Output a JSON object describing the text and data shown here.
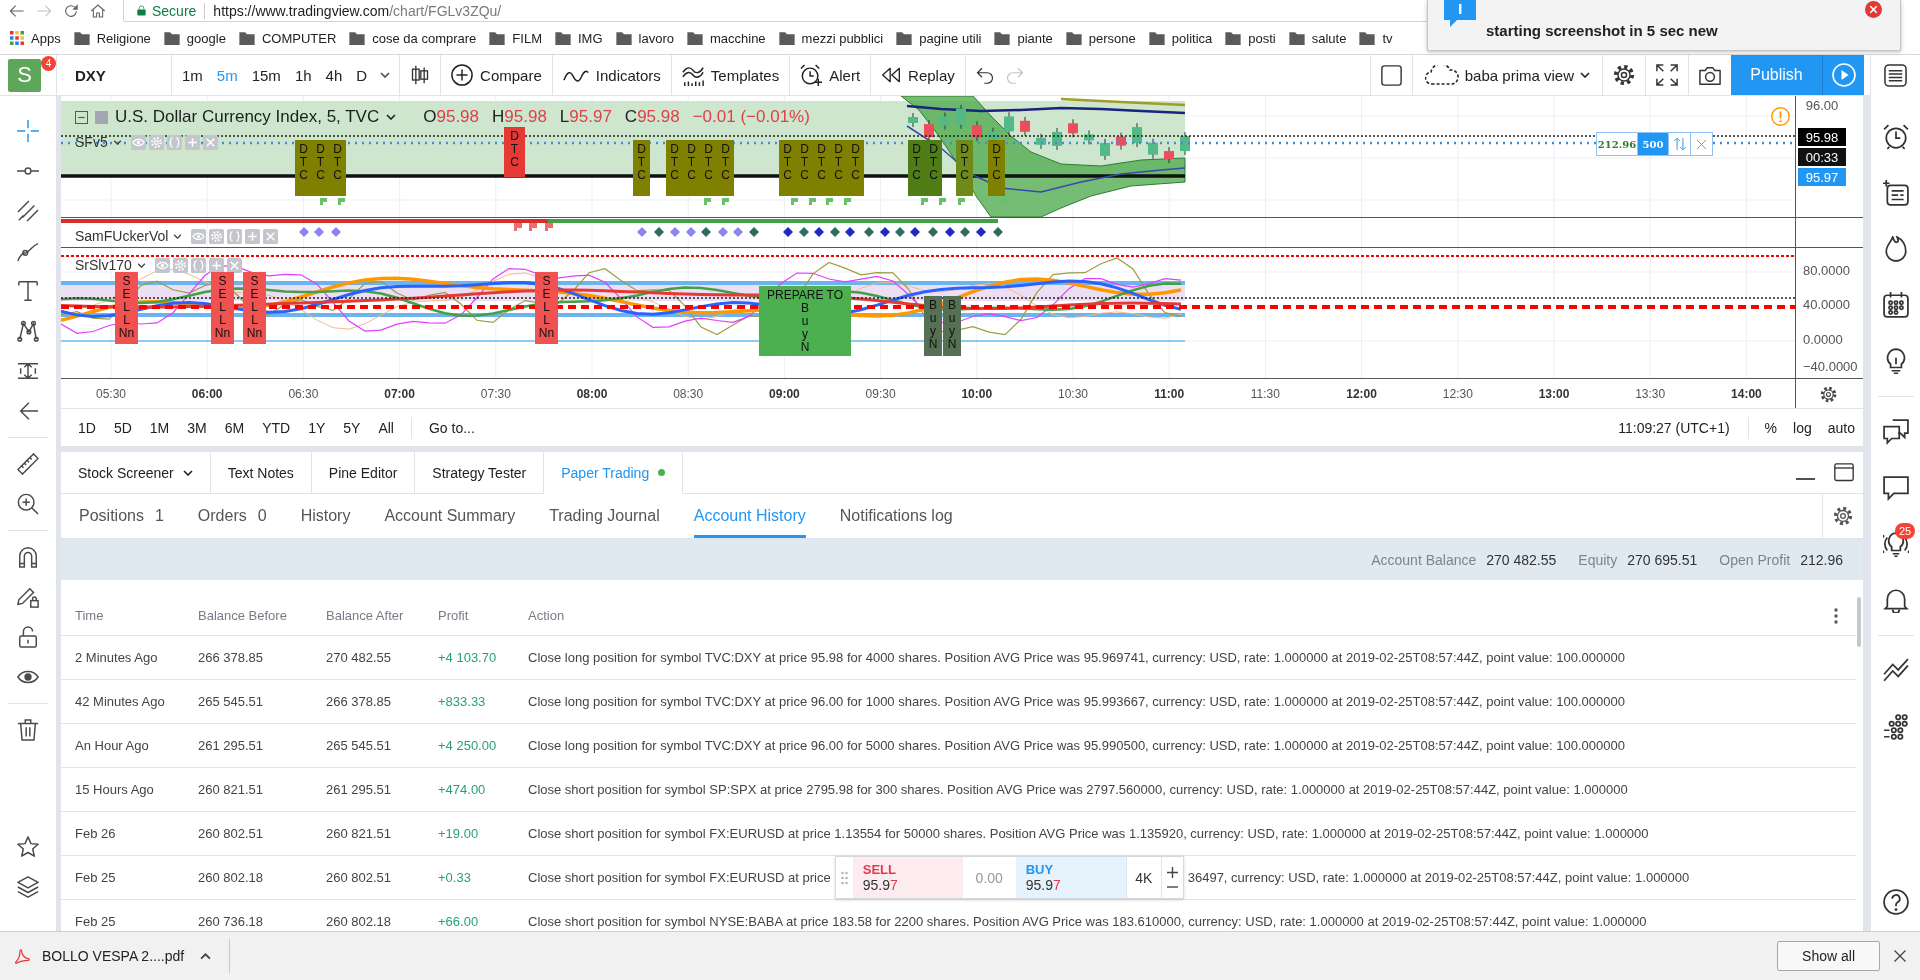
{
  "browser": {
    "secure_label": "Secure",
    "url_host": "https://www.tradingview.com",
    "url_path": "/chart/FGLv3ZQu/",
    "bookmarks": [
      {
        "label": "Apps",
        "kind": "apps"
      },
      {
        "label": "Religione",
        "kind": "folder"
      },
      {
        "label": "google",
        "kind": "folder"
      },
      {
        "label": "COMPUTER",
        "kind": "folder"
      },
      {
        "label": "cose da comprare",
        "kind": "folder"
      },
      {
        "label": "FILM",
        "kind": "folder"
      },
      {
        "label": "IMG",
        "kind": "folder"
      },
      {
        "label": "lavoro",
        "kind": "folder"
      },
      {
        "label": "macchine",
        "kind": "folder"
      },
      {
        "label": "mezzi pubblici",
        "kind": "folder"
      },
      {
        "label": "pagine utili",
        "kind": "folder"
      },
      {
        "label": "piante",
        "kind": "folder"
      },
      {
        "label": "persone",
        "kind": "folder"
      },
      {
        "label": "politica",
        "kind": "folder"
      },
      {
        "label": "posti",
        "kind": "folder"
      },
      {
        "label": "salute",
        "kind": "folder"
      },
      {
        "label": "tv",
        "kind": "folder"
      }
    ]
  },
  "notification": {
    "message": "starting screenshot in 5 sec new"
  },
  "toolbar": {
    "avatar": "S",
    "avatar_badge": "4",
    "symbol": "DXY",
    "intervals": [
      {
        "label": "1m",
        "selected": false
      },
      {
        "label": "5m",
        "selected": true
      },
      {
        "label": "15m",
        "selected": false
      },
      {
        "label": "1h",
        "selected": false
      },
      {
        "label": "4h",
        "selected": false
      },
      {
        "label": "D",
        "selected": false
      }
    ],
    "tools": [
      {
        "label": "Compare",
        "kind": "compare"
      },
      {
        "label": "Indicators",
        "kind": "indicators"
      },
      {
        "label": "Templates",
        "kind": "templates"
      },
      {
        "label": "Alert",
        "kind": "alert"
      },
      {
        "label": "Replay",
        "kind": "replay"
      }
    ],
    "layout_name": "baba prima view",
    "publish": "Publish"
  },
  "chart": {
    "legend": {
      "title": "U.S. Dollar Currency Index, 5, TVC",
      "ohlc": [
        {
          "key": "O",
          "value": "95.98"
        },
        {
          "key": "H",
          "value": "95.98"
        },
        {
          "key": "L",
          "value": "95.97"
        },
        {
          "key": "C",
          "value": "95.98"
        }
      ],
      "change": "−0.01 (−0.01%)"
    },
    "studies": [
      {
        "name": "SFv5"
      },
      {
        "name": "SamFUckerVol"
      },
      {
        "name": "SrSlv170"
      }
    ],
    "signals": [
      {
        "text": "D\nT\nC",
        "color": "#808000"
      },
      {
        "text": "D\nT\nC",
        "color": "#808000"
      },
      {
        "text": "D\nT\nC",
        "color": "#808000"
      },
      {
        "text": "D\nT\nC",
        "color": "#e53935"
      },
      {
        "text": "D\nT\nC",
        "color": "#808000"
      },
      {
        "text": "D\nT\nC",
        "color": "#808000"
      },
      {
        "text": "D\nT\nC",
        "color": "#808000"
      },
      {
        "text": "D\nT\nC",
        "color": "#808000"
      },
      {
        "text": "D\nT\nC",
        "color": "#808000"
      },
      {
        "text": "D\nT\nC",
        "color": "#808000"
      },
      {
        "text": "D\nT\nC",
        "color": "#808000"
      },
      {
        "text": "D\nT\nC",
        "color": "#808000"
      },
      {
        "text": "D\nT\nC",
        "color": "#808000"
      },
      {
        "text": "D\nT\nC",
        "color": "#808000"
      },
      {
        "text": "D\nT\nC",
        "color": "#4f7c14"
      },
      {
        "text": "D\nT\nC",
        "color": "#4f7c14"
      },
      {
        "text": "D\nT\nC",
        "color": "#6f8a1a"
      },
      {
        "text": "D\nT\nC",
        "color": "#808000"
      }
    ],
    "oscillator_signals": [
      {
        "text": "S\nE\nL\nL\nNn",
        "color": "#f05252"
      },
      {
        "text": "S\nE\nL\nL\nNn",
        "color": "#f05252"
      },
      {
        "text": "S\nE\nL\nL\nNn",
        "color": "#f05252"
      },
      {
        "text": "S\nE\nL\nL\nNn",
        "color": "#f05252"
      },
      {
        "text": "PREPARE TO\nB\nu\ny\nN",
        "color": "#4caf50"
      },
      {
        "text": "B\nu\ny\nN",
        "color": "#557055"
      },
      {
        "text": "B\nu\ny\nN",
        "color": "#557055"
      }
    ],
    "price_axis": [
      {
        "label": "96.00",
        "kind": "tick"
      },
      {
        "label": "95.98",
        "kind": "last"
      },
      {
        "label": "00:33",
        "kind": "countdown"
      },
      {
        "label": "95.97",
        "kind": "bid"
      }
    ],
    "position": {
      "profit": "212.96",
      "quantity": "500"
    },
    "oscillator_axis": [
      "80.0000",
      "40.0000",
      "0.0000",
      "−40.0000"
    ],
    "time_axis": [
      {
        "label": "05:30",
        "bold": false
      },
      {
        "label": "06:00",
        "bold": true
      },
      {
        "label": "06:30",
        "bold": false
      },
      {
        "label": "07:00",
        "bold": true
      },
      {
        "label": "07:30",
        "bold": false
      },
      {
        "label": "08:00",
        "bold": true
      },
      {
        "label": "08:30",
        "bold": false
      },
      {
        "label": "09:00",
        "bold": true
      },
      {
        "label": "09:30",
        "bold": false
      },
      {
        "label": "10:00",
        "bold": true
      },
      {
        "label": "10:30",
        "bold": false
      },
      {
        "label": "11:00",
        "bold": true
      },
      {
        "label": "11:30",
        "bold": false
      },
      {
        "label": "12:00",
        "bold": true
      },
      {
        "label": "12:30",
        "bold": false
      },
      {
        "label": "13:00",
        "bold": true
      },
      {
        "label": "13:30",
        "bold": false
      },
      {
        "label": "14:00",
        "bold": true
      }
    ]
  },
  "range_bar": {
    "ranges": [
      "1D",
      "5D",
      "1M",
      "3M",
      "6M",
      "YTD",
      "1Y",
      "5Y",
      "All"
    ],
    "goto": "Go to...",
    "clock": "11:09:27 (UTC+1)",
    "options": [
      "%",
      "log",
      "auto"
    ]
  },
  "panel": {
    "tabs": [
      {
        "label": "Stock Screener",
        "kind": "dropdown",
        "selected": false
      },
      {
        "label": "Text Notes",
        "kind": "plain",
        "selected": false
      },
      {
        "label": "Pine Editor",
        "kind": "plain",
        "selected": false
      },
      {
        "label": "Strategy Tester",
        "kind": "plain",
        "selected": false
      },
      {
        "label": "Paper Trading",
        "kind": "status",
        "selected": true
      }
    ],
    "subtabs": [
      {
        "label": "Positions",
        "count": "1",
        "selected": false
      },
      {
        "label": "Orders",
        "count": "0",
        "selected": false
      },
      {
        "label": "History",
        "selected": false
      },
      {
        "label": "Account Summary",
        "selected": false
      },
      {
        "label": "Trading Journal",
        "selected": false
      },
      {
        "label": "Account History",
        "selected": true
      },
      {
        "label": "Notifications log",
        "selected": false
      }
    ],
    "summary": [
      {
        "label": "Account Balance",
        "value": "270 482.55"
      },
      {
        "label": "Equity",
        "value": "270 695.51"
      },
      {
        "label": "Open Profit",
        "value": "212.96"
      }
    ],
    "table": {
      "columns": [
        "Time",
        "Balance Before",
        "Balance After",
        "Profit",
        "Action"
      ],
      "rows": [
        {
          "kind": "full",
          "time": "2 Minutes Ago",
          "balance_before": "266 378.85",
          "balance_after": "270 482.55",
          "profit": "+4 103.70",
          "action": "Close long position for symbol TVC:DXY at price 95.98 for 4000 shares. Position AVG Price was 95.969741, currency: USD, rate: 1.000000 at 2019-02-25T08:57:44Z, point value: 100.000000"
        },
        {
          "kind": "full",
          "time": "42 Minutes Ago",
          "balance_before": "265 545.51",
          "balance_after": "266 378.85",
          "profit": "+833.33",
          "action": "Close long position for symbol TVC:DXY at price 96.00 for 1000 shares. Position AVG Price was 95.993667, currency: USD, rate: 1.000000 at 2019-02-25T08:57:44Z, point value: 100.000000"
        },
        {
          "kind": "full",
          "time": "An Hour Ago",
          "balance_before": "261 295.51",
          "balance_after": "265 545.51",
          "profit": "+4 250.00",
          "action": "Close long position for symbol TVC:DXY at price 96.00 for 5000 shares. Position AVG Price was 95.990500, currency: USD, rate: 1.000000 at 2019-02-25T08:57:44Z, point value: 100.000000"
        },
        {
          "kind": "full",
          "time": "15 Hours Ago",
          "balance_before": "260 821.51",
          "balance_after": "261 295.51",
          "profit": "+474.00",
          "action": "Close short position for symbol SP:SPX at price 2795.98 for 300 shares. Position AVG Price was 2797.560000, currency: USD, rate: 1.000000 at 2019-02-25T08:57:44Z, point value: 1.000000"
        },
        {
          "kind": "full",
          "time": "Feb 26",
          "balance_before": "260 802.51",
          "balance_after": "260 821.51",
          "profit": "+19.00",
          "action": "Close short position for symbol FX:EURUSD at price 1.13554 for 50000 shares. Position AVG Price was 1.135920, currency: USD, rate: 1.000000 at 2019-02-25T08:57:44Z, point value: 1.000000"
        },
        {
          "kind": "split",
          "time": "Feb 25",
          "balance_before": "260 802.18",
          "balance_after": "260 802.51",
          "profit": "+0.33",
          "action_parts": [
            "Close short position for symbol FX:EURUSD at price",
            "36497, currency: USD, rate: 1.000000 at 2019-02-25T08:57:44Z, point value: 1.000000"
          ]
        },
        {
          "kind": "full",
          "time": "Feb 25",
          "balance_before": "260 736.18",
          "balance_after": "260 802.18",
          "profit": "+66.00",
          "action": "Close short position for symbol NYSE:BABA at price 183.58 for 2200 shares. Position AVG Price was 183.610000, currency: USD, rate: 1.000000 at 2019-02-25T08:57:44Z, point value: 1.000000"
        }
      ]
    }
  },
  "trade_widget": {
    "sell_label": "SELL",
    "sell_price": "95.97",
    "spread": "0.00",
    "buy_label": "BUY",
    "buy_price": "95.97",
    "quantity": "4K"
  },
  "sidebar": {
    "badge": "25"
  },
  "downloads": {
    "file": "BOLLO VESPA 2....pdf",
    "show_all": "Show all"
  }
}
